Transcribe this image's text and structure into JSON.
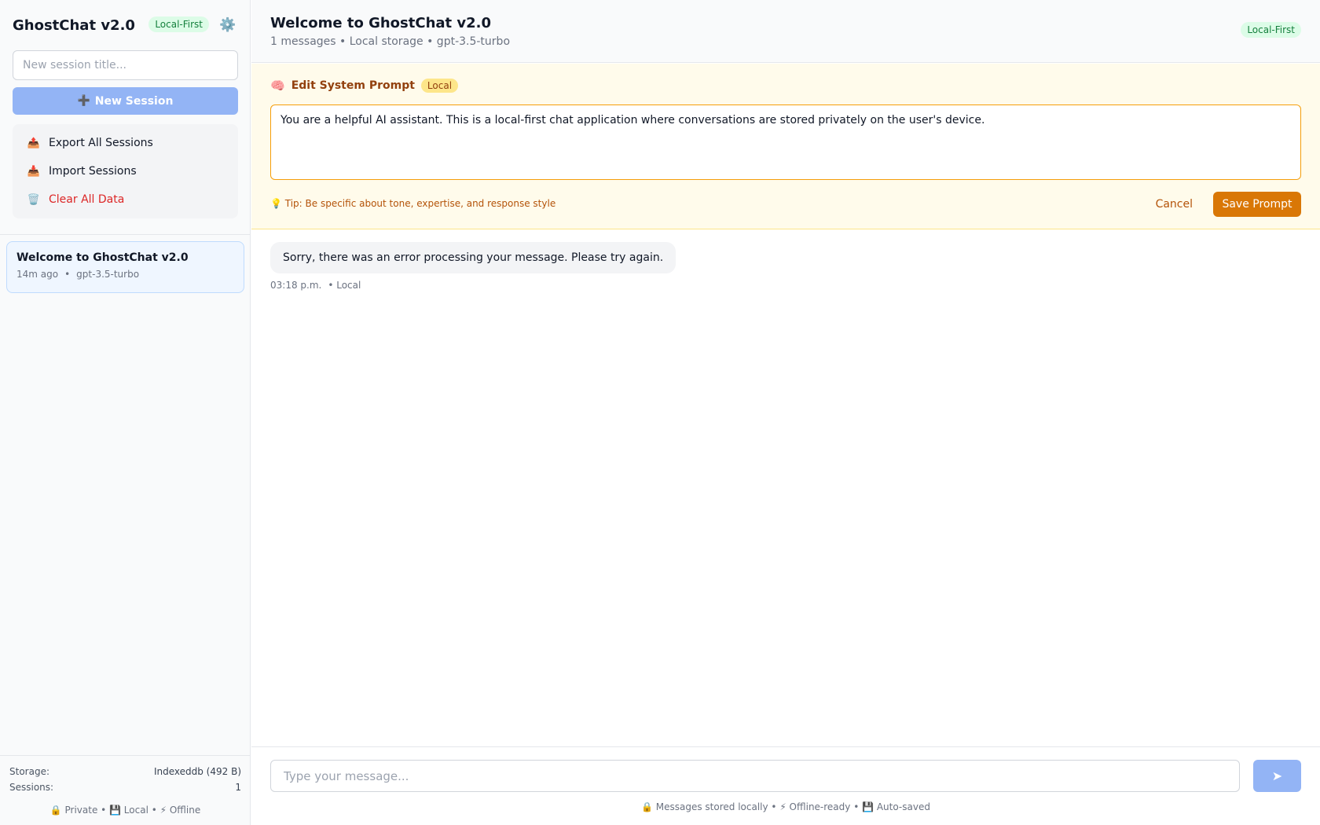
{
  "sidebar": {
    "app_title": "GhostChat v2.0",
    "badge": "Local-First",
    "settings_icon": "⚙️",
    "session_input_placeholder": "New session title...",
    "new_session_icon": "➕",
    "new_session_label": "New Session",
    "actions": [
      {
        "icon": "📤",
        "label": "Export All Sessions"
      },
      {
        "icon": "📥",
        "label": "Import Sessions"
      },
      {
        "icon": "🗑️",
        "label": "Clear All Data"
      }
    ],
    "sessions": [
      {
        "title": "Welcome to GhostChat v2.0",
        "time": "14m ago",
        "separator": "•",
        "model": "gpt-3.5-turbo"
      }
    ],
    "footer": {
      "storage_label": "Storage:",
      "storage_value": "Indexeddb (492 B)",
      "sessions_label": "Sessions:",
      "sessions_value": "1",
      "flags": "🔒 Private • 💾 Local • ⚡ Offline"
    }
  },
  "header": {
    "title": "Welcome to GhostChat v2.0",
    "meta": "1 messages • Local storage • gpt-3.5-turbo",
    "badge": "Local-First"
  },
  "system_prompt": {
    "icon": "🧠",
    "title": "Edit System Prompt",
    "badge": "Local",
    "text": "You are a helpful AI assistant. This is a local-first chat application where conversations are stored privately on the user's device.",
    "tip": "💡 Tip: Be specific about tone, expertise, and response style",
    "cancel_label": "Cancel",
    "save_label": "Save Prompt"
  },
  "messages": [
    {
      "text": "Sorry, there was an error processing your message. Please try again.",
      "time": "03:18 p.m.",
      "source": "• Local"
    }
  ],
  "composer": {
    "placeholder": "Type your message...",
    "send_icon": "➤",
    "footer": "🔒 Messages stored locally • ⚡ Offline-ready • 💾 Auto-saved"
  },
  "colors": {
    "accent_blue": "#93b4f5",
    "amber": "#d97706",
    "danger": "#dc2626",
    "green_badge": "#dcfce7"
  }
}
